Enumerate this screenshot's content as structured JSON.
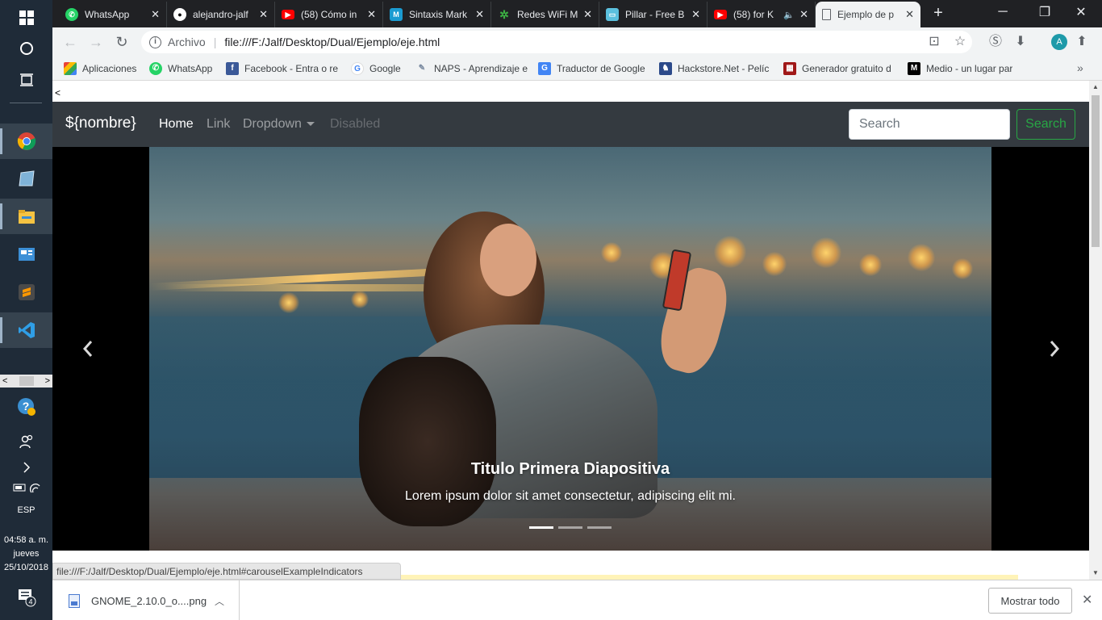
{
  "taskbar": {
    "language": "ESP",
    "time": "04:58 a. m.",
    "day": "jueves",
    "date": "25/10/2018",
    "notification_count": "4"
  },
  "tabs": [
    {
      "title": "WhatsApp",
      "icon": "whatsapp-icon",
      "color": "#25d366"
    },
    {
      "title": "alejandro-jalf",
      "icon": "github-icon",
      "color": "#ffffff"
    },
    {
      "title": "(58) Cómo in",
      "icon": "youtube-icon",
      "color": "#ff0000"
    },
    {
      "title": "Sintaxis Mark",
      "icon": "markdown-icon",
      "color": "#1b9bd1"
    },
    {
      "title": "Redes WiFi M",
      "icon": "wifi-icon",
      "color": "#3cb043"
    },
    {
      "title": "Pillar - Free B",
      "icon": "pillar-icon",
      "color": "#5bc0de"
    },
    {
      "title": "(58) for K",
      "icon": "youtube-icon",
      "color": "#ff0000"
    },
    {
      "title": "Ejemplo de p",
      "icon": "page-icon",
      "color": "#ffffff"
    }
  ],
  "address": {
    "scheme_label": "Archivo",
    "url": "file:///F:/Jalf/Desktop/Dual/Ejemplo/eje.html"
  },
  "bookmarks": [
    {
      "label": "Aplicaciones",
      "icon": "apps-grid-icon",
      "color": "#ea4335"
    },
    {
      "label": "WhatsApp",
      "icon": "whatsapp-icon",
      "color": "#25d366"
    },
    {
      "label": "Facebook - Entra o re",
      "icon": "facebook-icon",
      "color": "#3b5998"
    },
    {
      "label": "Google",
      "icon": "google-icon",
      "color": "#4285f4"
    },
    {
      "label": "NAPS - Aprendizaje e",
      "icon": "naps-icon",
      "color": "#7a8aa0"
    },
    {
      "label": "Traductor de Google",
      "icon": "translate-icon",
      "color": "#4285f4"
    },
    {
      "label": "Hackstore.Net - Pelíc",
      "icon": "hackstore-icon",
      "color": "#2c4a8a"
    },
    {
      "label": "Generador gratuito d",
      "icon": "generator-icon",
      "color": "#a01818"
    },
    {
      "label": "Medio - un lugar par",
      "icon": "medium-icon",
      "color": "#000000"
    }
  ],
  "page": {
    "stray_text": "<",
    "brand": "${nombre}",
    "nav": {
      "home": "Home",
      "link": "Link",
      "dropdown": "Dropdown",
      "disabled": "Disabled"
    },
    "search": {
      "placeholder": "Search",
      "button": "Search"
    },
    "carousel": {
      "caption_title": "Titulo Primera Diapositiva",
      "caption_text": "Lorem ipsum dolor sit amet consectetur, adipiscing elit mi.",
      "slide_count": 3,
      "active_slide": 1
    }
  },
  "status_url": "file:///F:/Jalf/Desktop/Dual/Ejemplo/eje.html#carouselExampleIndicators",
  "downloads": {
    "file_name": "GNOME_2.10.0_o....png",
    "show_all": "Mostrar todo"
  },
  "colors": {
    "navbar_bg": "#343a40",
    "success": "#28a745",
    "tabstrip_bg": "#202124"
  }
}
